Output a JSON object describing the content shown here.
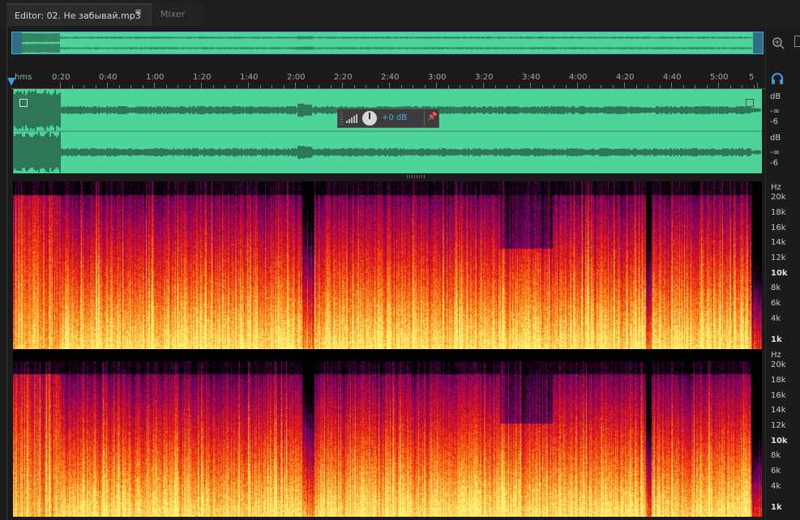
{
  "tabs": {
    "editor_label": "Editor: 02. Не забывай.mp3",
    "menu_glyph": "≡",
    "mixer_label": "Mixer"
  },
  "ruler": {
    "unit_label": "hms",
    "ticks": [
      "0:20",
      "0:40",
      "1:00",
      "1:20",
      "1:40",
      "2:00",
      "2:20",
      "2:40",
      "3:00",
      "3:20",
      "3:40",
      "4:00",
      "4:20",
      "4:40",
      "5:00",
      "5"
    ]
  },
  "db_scale": {
    "labels": [
      "dB",
      "-∞",
      "-6",
      "dB",
      "-∞",
      "-6"
    ]
  },
  "hud": {
    "volume_value": "+0 dB"
  },
  "hz_scale_top": {
    "labels": [
      "Hz",
      "20k",
      "18k",
      "16k",
      "14k",
      "12k",
      "10k",
      "8k",
      "6k",
      "4k",
      "1k"
    ]
  },
  "hz_scale_bottom": {
    "labels": [
      "Hz",
      "20k",
      "18k",
      "16k",
      "14k",
      "12k",
      "10k",
      "8k",
      "6k",
      "4k",
      "1k"
    ]
  },
  "colors": {
    "waveform_bg": "#4ed49b",
    "accent": "#3f9ae0"
  },
  "icons": [
    "zoom-icon",
    "headphones-icon",
    "pin-icon",
    "menu-icon",
    "level-meter-icon"
  ]
}
